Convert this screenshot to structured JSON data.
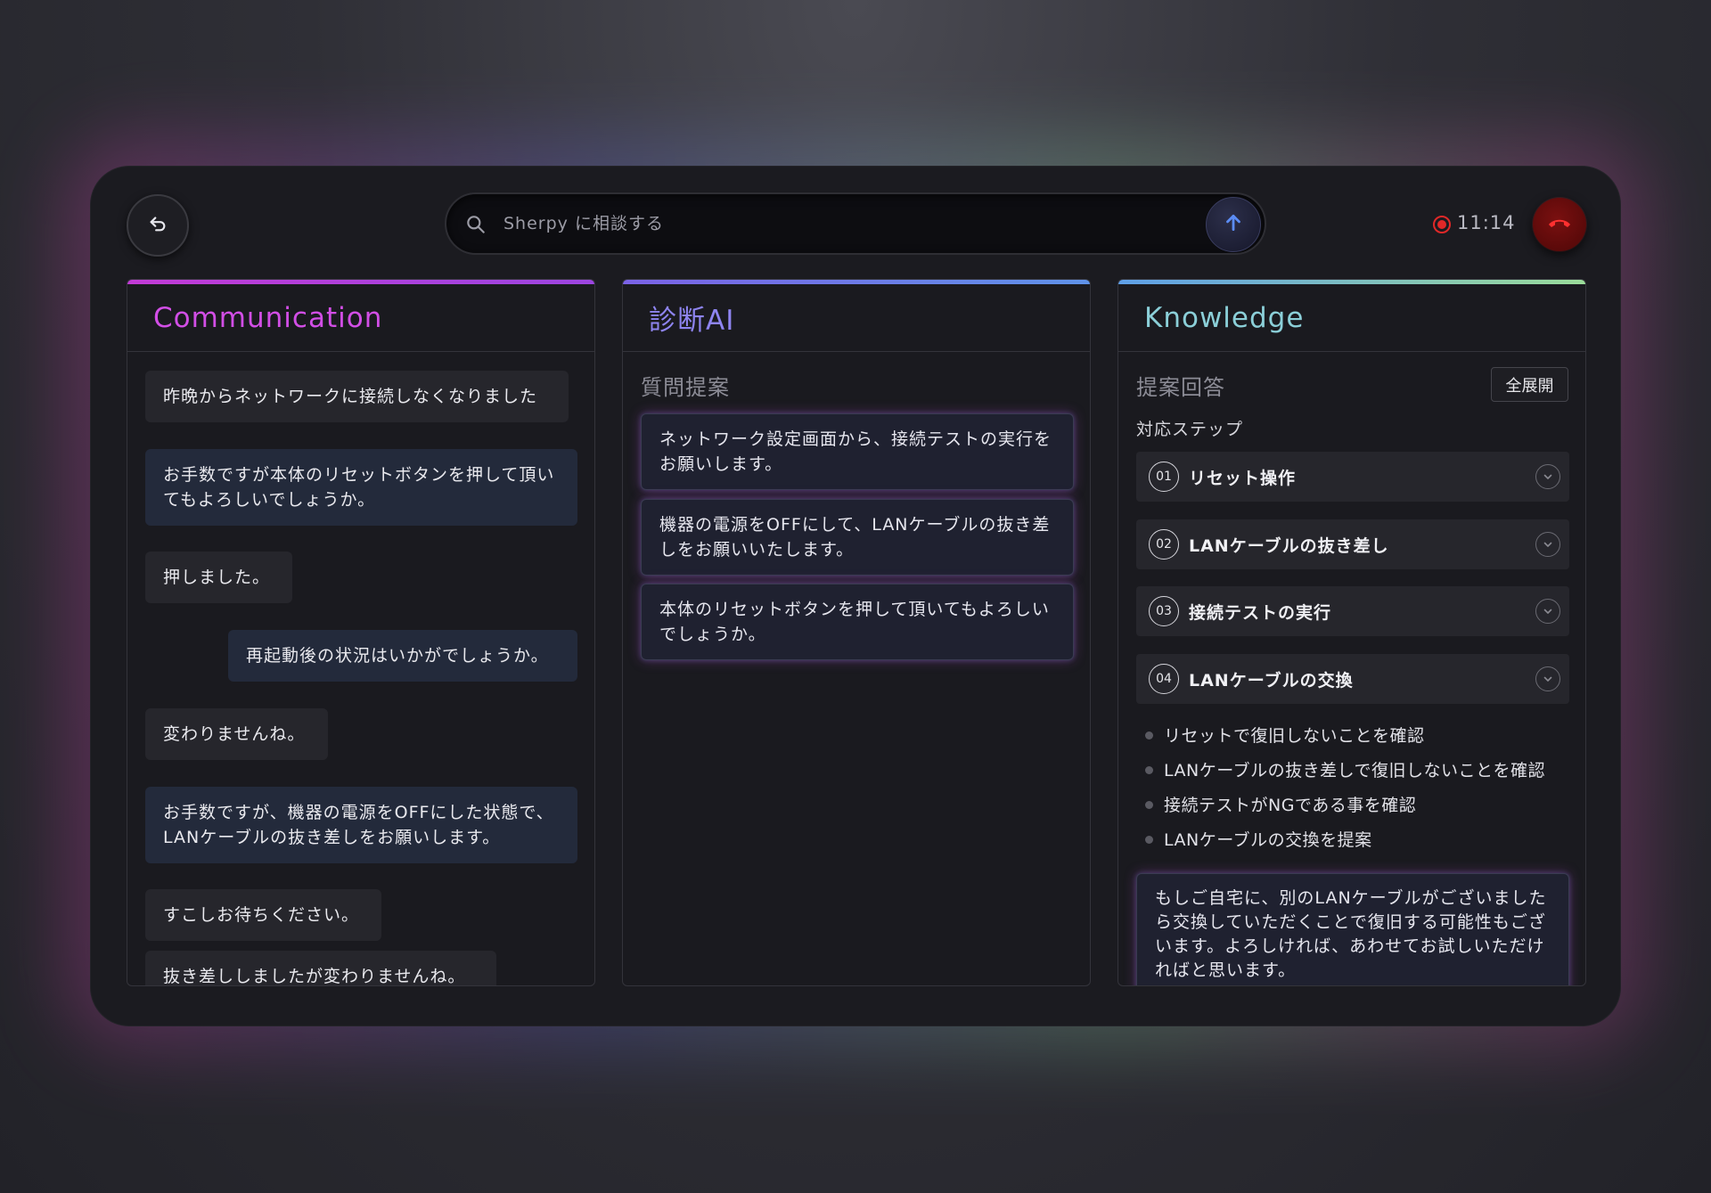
{
  "topbar": {
    "search_placeholder": "Sherpy に相談する",
    "time": "11:14"
  },
  "panels": {
    "communication": {
      "title": "Communication",
      "messages": [
        {
          "role": "customer",
          "text": "昨晩からネットワークに接続しなくなりました"
        },
        {
          "role": "operator",
          "text": "お手数ですが本体のリセットボタンを押して頂いてもよろしいでしょうか。"
        },
        {
          "role": "customer",
          "text": "押しました。"
        },
        {
          "role": "operator",
          "text": "再起動後の状況はいかがでしょうか。"
        },
        {
          "role": "customer",
          "text": "変わりませんね。"
        },
        {
          "role": "operator",
          "text": "お手数ですが、機器の電源をOFFにした状態で、LANケーブルの抜き差しをお願いします。"
        },
        {
          "role": "customer",
          "text": "すこしお待ちください。"
        },
        {
          "role": "customer",
          "text": "抜き差ししましたが変わりませんね。"
        }
      ]
    },
    "diagnosis": {
      "title": "診断AI",
      "subtitle": "質問提案",
      "suggestions": [
        "ネットワーク設定画面から、接続テストの実行をお願いします。",
        "機器の電源をOFFにして、LANケーブルの抜き差しをお願いいたします。",
        "本体のリセットボタンを押して頂いてもよろしいでしょうか。"
      ]
    },
    "knowledge": {
      "title": "Knowledge",
      "subtitle": "提案回答",
      "expand_label": "全展開",
      "steps_label": "対応ステップ",
      "steps": [
        {
          "num": "01",
          "title": "リセット操作"
        },
        {
          "num": "02",
          "title": "LANケーブルの抜き差し"
        },
        {
          "num": "03",
          "title": "接続テストの実行"
        },
        {
          "num": "04",
          "title": "LANケーブルの交換"
        }
      ],
      "bullets": [
        "リセットで復旧しないことを確認",
        "LANケーブルの抜き差しで復旧しないことを確認",
        "接続テストがNGである事を確認",
        "LANケーブルの交換を提案"
      ],
      "answer": "もしご自宅に、別のLANケーブルがございましたら交換していただくことで復旧する可能性もございます。よろしければ、あわせてお試しいただければと思います。"
    }
  },
  "colors": {
    "communication_accent": "#d24ee6",
    "diagnosis_accent": "#8e84f0",
    "knowledge_accent": "#8bcfd8",
    "hangup": "#7a1010",
    "recording": "#e02828"
  },
  "icons": [
    "back-arrow-icon",
    "search-icon",
    "arrow-up-icon",
    "recording-icon",
    "phone-hangup-icon",
    "chevron-down-icon"
  ]
}
